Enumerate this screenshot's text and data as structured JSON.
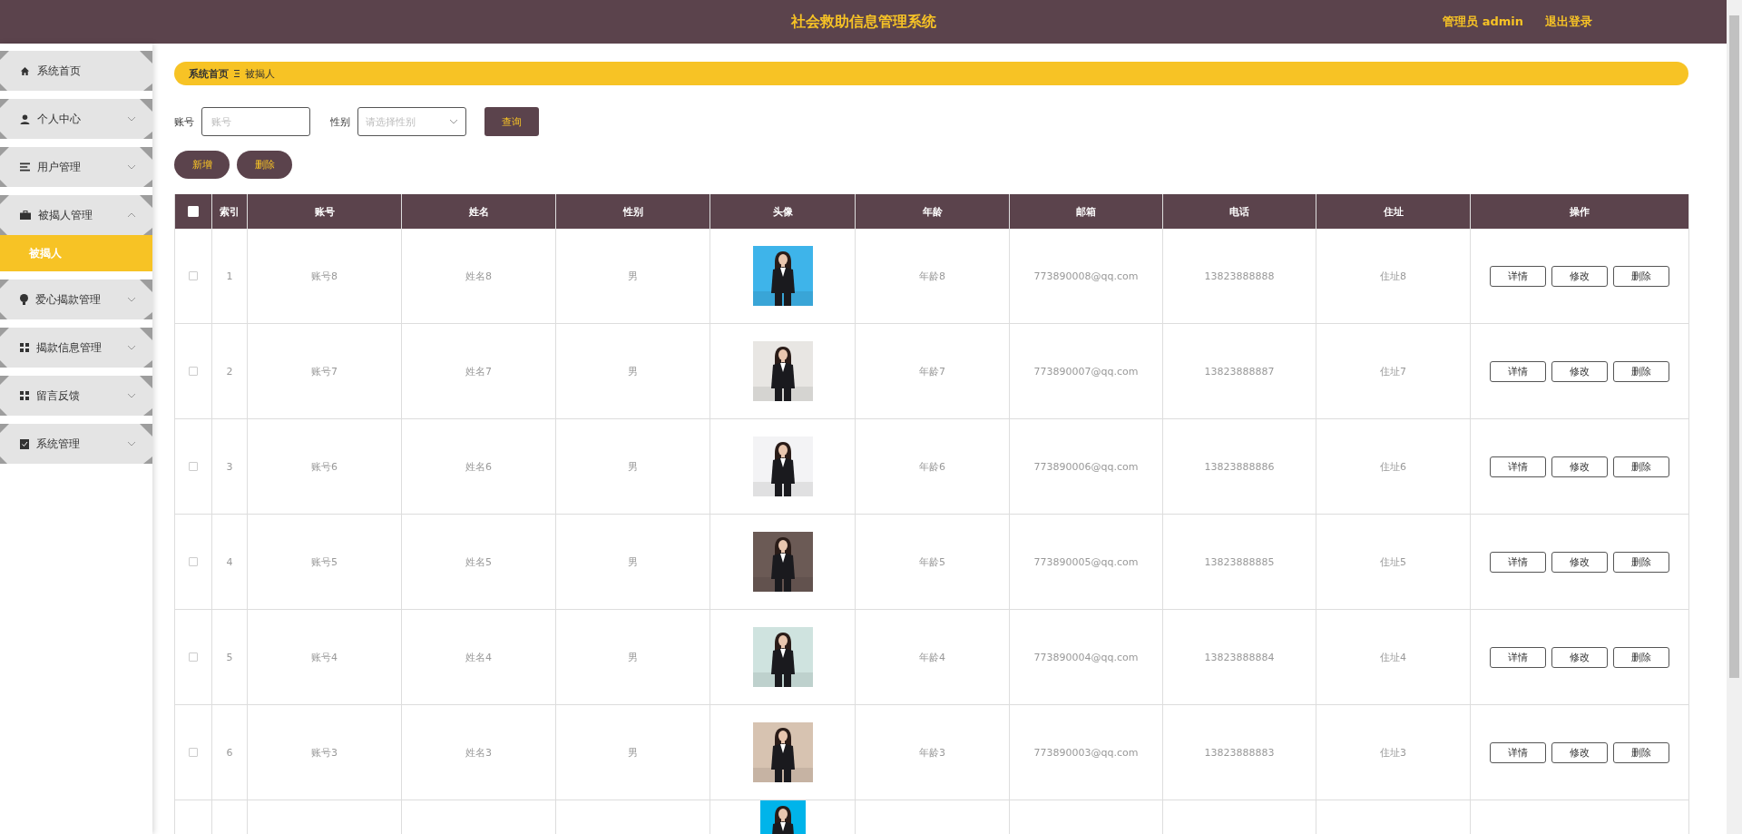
{
  "header": {
    "title": "社会救助信息管理系统",
    "user": "管理员 admin",
    "logout": "退出登录"
  },
  "sidebar": {
    "items": [
      {
        "label": "系统首页",
        "kind": "home"
      },
      {
        "label": "个人中心",
        "kind": "user",
        "expanded": false
      },
      {
        "label": "用户管理",
        "kind": "list",
        "expanded": false
      },
      {
        "label": "被揭人管理",
        "kind": "briefcase",
        "expanded": true,
        "children": [
          {
            "label": "被揭人",
            "selected": true
          }
        ]
      },
      {
        "label": "爱心揭款管理",
        "kind": "bulb",
        "expanded": false
      },
      {
        "label": "揭款信息管理",
        "kind": "grid",
        "expanded": false
      },
      {
        "label": "留言反馈",
        "kind": "grid",
        "expanded": false
      },
      {
        "label": "系统管理",
        "kind": "clipboard",
        "expanded": false
      }
    ]
  },
  "breadcrumb": [
    "系统首页",
    "被揭人"
  ],
  "search": {
    "fields": [
      {
        "label": "账号",
        "placeholder": "账号",
        "kind": "text"
      },
      {
        "label": "性别",
        "placeholder": "请选择性别",
        "kind": "select"
      }
    ],
    "button": "查询"
  },
  "actions": [
    "新增",
    "删除"
  ],
  "table": {
    "select_all": {
      "checked": false
    },
    "columns": [
      "索引",
      "账号",
      "姓名",
      "性别",
      "头像",
      "年龄",
      "邮箱",
      "电话",
      "住址",
      "操作"
    ],
    "rows": [
      {
        "checked": false,
        "index": "1",
        "account": "账号8",
        "name": "姓名8",
        "gender": "男",
        "avatar": {
          "kind": "picture"
        },
        "age": "年龄8",
        "email": "773890008@qq.com",
        "phone": "13823888888",
        "address": "住址8",
        "buttons": [
          "详情",
          "修改",
          "删除"
        ]
      },
      {
        "checked": false,
        "index": "2",
        "account": "账号7",
        "name": "姓名7",
        "gender": "男",
        "avatar": {
          "kind": "picture"
        },
        "age": "年龄7",
        "email": "773890007@qq.com",
        "phone": "13823888887",
        "address": "住址7",
        "buttons": [
          "详情",
          "修改",
          "删除"
        ]
      },
      {
        "checked": false,
        "index": "3",
        "account": "账号6",
        "name": "姓名6",
        "gender": "男",
        "avatar": {
          "kind": "picture"
        },
        "age": "年龄6",
        "email": "773890006@qq.com",
        "phone": "13823888886",
        "address": "住址6",
        "buttons": [
          "详情",
          "修改",
          "删除"
        ]
      },
      {
        "checked": false,
        "index": "4",
        "account": "账号5",
        "name": "姓名5",
        "gender": "男",
        "avatar": {
          "kind": "picture"
        },
        "age": "年龄5",
        "email": "773890005@qq.com",
        "phone": "13823888885",
        "address": "住址5",
        "buttons": [
          "详情",
          "修改",
          "删除"
        ]
      },
      {
        "checked": false,
        "index": "5",
        "account": "账号4",
        "name": "姓名4",
        "gender": "男",
        "avatar": {
          "kind": "picture"
        },
        "age": "年龄4",
        "email": "773890004@qq.com",
        "phone": "13823888884",
        "address": "住址4",
        "buttons": [
          "详情",
          "修改",
          "删除"
        ]
      },
      {
        "checked": false,
        "index": "6",
        "account": "账号3",
        "name": "姓名3",
        "gender": "男",
        "avatar": {
          "kind": "picture"
        },
        "age": "年龄3",
        "email": "773890003@qq.com",
        "phone": "13823888883",
        "address": "住址3",
        "buttons": [
          "详情",
          "修改",
          "删除"
        ]
      },
      {
        "avatar": {
          "kind": "picture"
        }
      }
    ]
  }
}
